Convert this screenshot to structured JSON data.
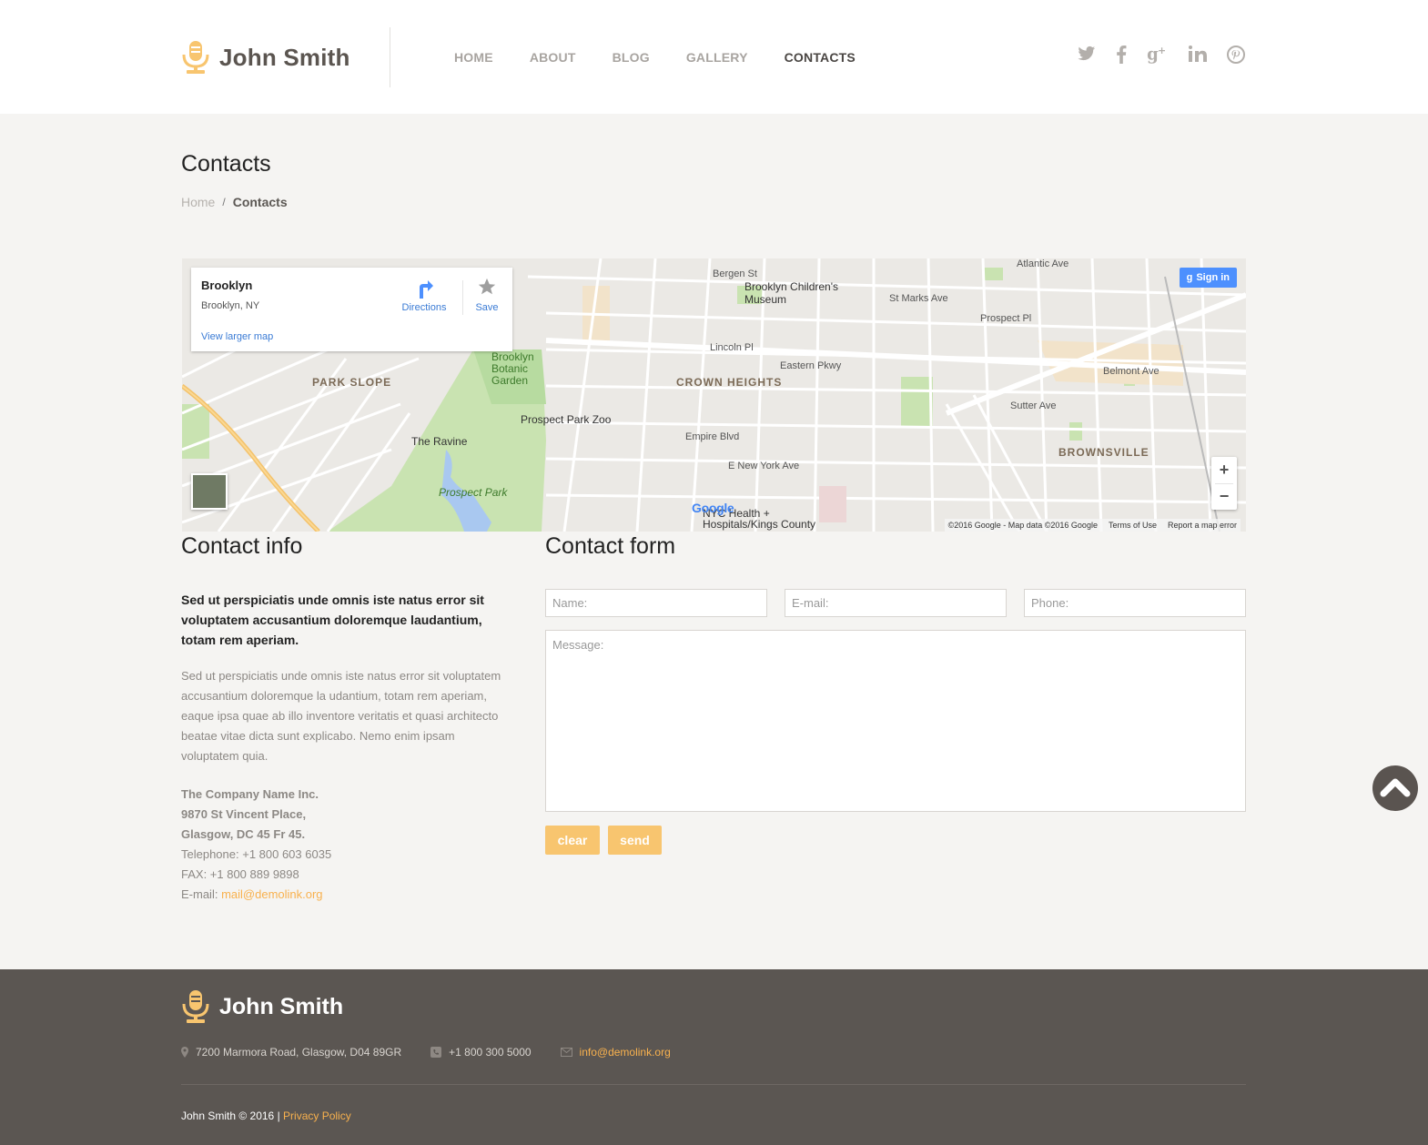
{
  "brand": {
    "name": "John Smith"
  },
  "nav": {
    "items": [
      "HOME",
      "ABOUT",
      "BLOG",
      "GALLERY",
      "CONTACTS"
    ],
    "active": "CONTACTS"
  },
  "social": [
    "twitter-icon",
    "facebook-icon",
    "google-plus-icon",
    "linkedin-icon",
    "pinterest-icon"
  ],
  "page": {
    "title": "Contacts",
    "breadcrumb": {
      "home": "Home",
      "separator": "/",
      "current": "Contacts"
    }
  },
  "map": {
    "card": {
      "title": "Brooklyn",
      "subtitle": "Brooklyn, NY",
      "directions": "Directions",
      "save": "Save",
      "larger_map": "View larger map"
    },
    "sign_in": "Sign in",
    "labels": {
      "park_slope": "PARK SLOPE",
      "crown_heights": "CROWN HEIGHTS",
      "brownsville": "BROWNSVILLE",
      "childrens_museum": "Brooklyn Children's Museum",
      "botanic_garden": "Brooklyn Botanic Garden",
      "zoo": "Prospect Park Zoo",
      "ravine": "The Ravine",
      "prospect_park": "Prospect Park",
      "eastern_pkwy": "Eastern Pkwy",
      "empire_blvd": "Empire Blvd",
      "atlantic_ave": "Atlantic Ave",
      "sutter_ave": "Sutter Ave",
      "belmont_ave": "Belmont Ave",
      "lincoln_pl": "Lincoln Pl",
      "new_york_ave": "E New York Ave",
      "hospital": "NYC Health + Hospitals/Kings County",
      "st_marks": "St Marks Ave",
      "prospect_pl": "Prospect Pl",
      "bergen_st": "Bergen St"
    },
    "google": "Google",
    "footer": {
      "copyright": "©2016 Google - Map data ©2016 Google",
      "terms": "Terms of Use",
      "report": "Report a map error"
    },
    "zoom_in": "+",
    "zoom_out": "−"
  },
  "contact_info": {
    "title": "Contact info",
    "lead": "Sed ut perspiciatis unde omnis iste natus error sit voluptatem accusantium doloremque laudantium, totam rem aperiam.",
    "body": "Sed ut perspiciatis unde omnis iste natus error sit voluptatem accusantium doloremque la udantium, totam rem aperiam, eaque ipsa quae ab illo inventore veritatis et quasi architecto beatae vitae dicta sunt explicabo. Nemo enim ipsam voluptatem quia.",
    "company": "The Company Name Inc.",
    "street": "9870 St Vincent Place,",
    "city": "Glasgow, DC 45 Fr 45.",
    "telephone": "Telephone: +1 800 603 6035",
    "fax": "FAX: +1 800 889 9898",
    "email_label": "E-mail:",
    "email": "mail@demolink.org"
  },
  "contact_form": {
    "title": "Contact form",
    "name_placeholder": "Name:",
    "email_placeholder": "E-mail:",
    "phone_placeholder": "Phone:",
    "message_placeholder": "Message:",
    "clear": "clear",
    "send": "send"
  },
  "footer": {
    "brand": "John Smith",
    "address": "7200 Marmora Road, Glasgow, D04 89GR",
    "phone": "+1 800 300 5000",
    "email": "info@demolink.org",
    "copyright": "John Smith © 2016 |",
    "privacy": "Privacy Policy"
  },
  "colors": {
    "accent": "#f8b14e",
    "button": "#f8c56f",
    "footer_bg": "#5b5652",
    "page_bg": "#f5f4f2"
  }
}
